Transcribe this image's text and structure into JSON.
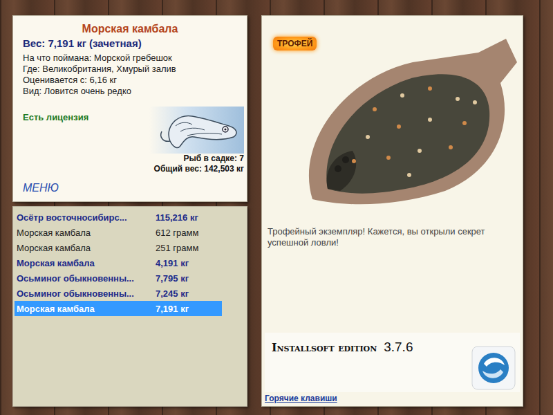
{
  "fish_card": {
    "title": "Морская камбала",
    "weight": "Вес: 7,191 кг (зачетная)",
    "bait": "На что поймана: Морской гребешок",
    "location": "Где: Великобритания, Хмурый залив",
    "rating": "Оценивается с: 6,16 кг",
    "rarity": "Вид: Ловится очень редко",
    "license": "Есть лицензия",
    "menu": "МЕНЮ",
    "count": "Рыб в садке: 7",
    "total_weight": "Общий вес: 142,503 кг"
  },
  "catch_list": [
    {
      "name": "Осётр восточносибирс...",
      "weight": "115,216 кг",
      "counted": true,
      "selected": false
    },
    {
      "name": "Морская камбала",
      "weight": "612 грамм",
      "counted": false,
      "selected": false
    },
    {
      "name": "Морская камбала",
      "weight": "251 грамм",
      "counted": false,
      "selected": false
    },
    {
      "name": "Морская камбала",
      "weight": "4,191 кг",
      "counted": true,
      "selected": false
    },
    {
      "name": "Осьминог обыкновенны...",
      "weight": "7,795 кг",
      "counted": true,
      "selected": false
    },
    {
      "name": "Осьминог обыкновенны...",
      "weight": "7,245 кг",
      "counted": true,
      "selected": false
    },
    {
      "name": "Морская камбала",
      "weight": "7,191 кг",
      "counted": true,
      "selected": true
    }
  ],
  "detail": {
    "badge": "ТРОФЕЙ",
    "description": "Трофейный экземпляр! Кажется, вы открыли секрет успешной ловли!",
    "edition": "Installsoft edition",
    "version": "3.7.6",
    "hotkeys": "Горячие клавиши"
  }
}
